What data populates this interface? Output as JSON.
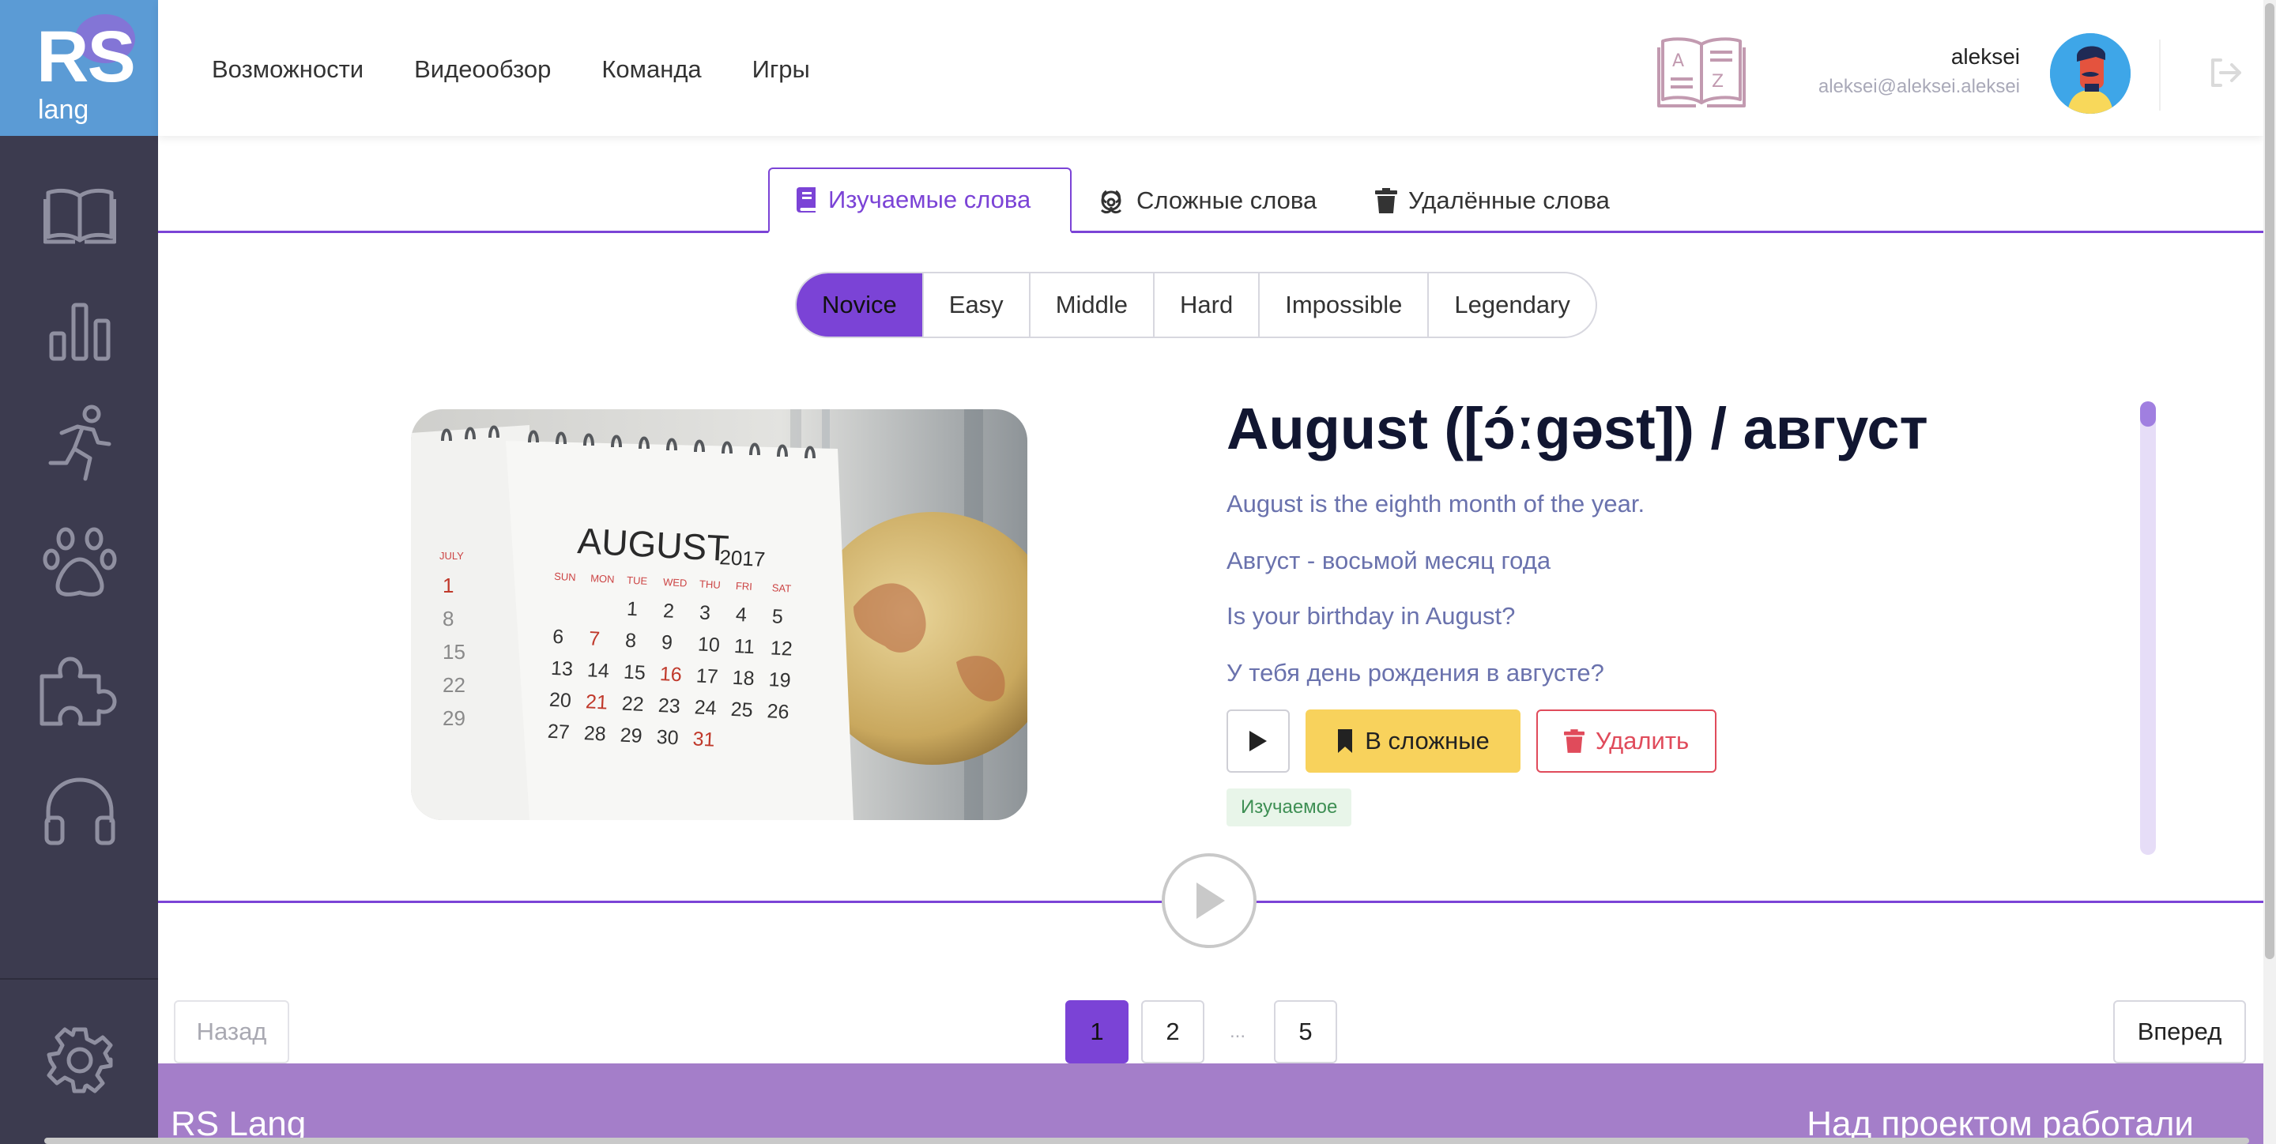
{
  "app": {
    "logo_main": "RS",
    "logo_sub": "lang"
  },
  "sidebar": {
    "items": [
      {
        "icon": "book-icon"
      },
      {
        "icon": "bar-chart-icon"
      },
      {
        "icon": "running-man-icon"
      },
      {
        "icon": "paw-icon"
      },
      {
        "icon": "puzzle-icon"
      },
      {
        "icon": "headphones-icon"
      }
    ],
    "settings_icon": "gear-icon"
  },
  "header": {
    "nav": [
      "Возможности",
      "Видеообзор",
      "Команда",
      "Игры"
    ],
    "dictionary_icon": "dictionary-az-icon",
    "user": {
      "name": "aleksei",
      "email": "aleksei@aleksei.aleksei"
    },
    "logout_icon": "logout-icon"
  },
  "tabs": [
    {
      "label": "Изучаемые слова",
      "icon": "book-icon",
      "active": true
    },
    {
      "label": "Сложные слова",
      "icon": "biohazard-icon",
      "active": false
    },
    {
      "label": "Удалённые слова",
      "icon": "trash-icon",
      "active": false
    }
  ],
  "levels": [
    "Novice",
    "Easy",
    "Middle",
    "Hard",
    "Impossible",
    "Legendary"
  ],
  "active_level": "Novice",
  "word": {
    "title": "August ([ɔ́ːgəst]) / август",
    "meaning_en": "August is the eighth month of the year.",
    "meaning_ru": "Август - восьмой месяц года",
    "example_en": "Is your birthday in August?",
    "example_ru": "У тебя день рождения в августе?",
    "image": {
      "calendar_title": "AUGUST",
      "year": "2017",
      "days_header": [
        "SUN",
        "MON",
        "TUE",
        "WED",
        "THU",
        "FRI",
        "SAT"
      ],
      "rows": [
        [
          "",
          "",
          "1",
          "2",
          "3",
          "4",
          "5"
        ],
        [
          "6",
          "7",
          "8",
          "9",
          "10",
          "11",
          "12"
        ],
        [
          "13",
          "14",
          "15",
          "16",
          "17",
          "18",
          "19"
        ],
        [
          "20",
          "21",
          "22",
          "23",
          "24",
          "25",
          "26"
        ],
        [
          "27",
          "28",
          "29",
          "30",
          "31",
          "",
          ""
        ]
      ],
      "prev_page_label": "JULY",
      "prev_page_days": [
        "1",
        "8",
        "15",
        "22",
        "29"
      ]
    },
    "buttons": {
      "play_icon": "play-icon",
      "hard_label": "В сложные",
      "hard_icon": "bookmark-icon",
      "delete_label": "Удалить",
      "delete_icon": "trash-icon"
    },
    "status": "Изучаемое"
  },
  "pagination": {
    "prev": "Назад",
    "next": "Вперед",
    "pages": [
      "1",
      "2",
      "5"
    ],
    "ellipsis": "...",
    "current": "1"
  },
  "footer": {
    "left": "RS Lang",
    "right": "Над проектом работали"
  },
  "colors": {
    "accent": "#7b43d6",
    "sidebar": "#3c3b4f",
    "logo_bg": "#5b9bd5",
    "meaning_text": "#6a72ad",
    "hard_button": "#f8d25c",
    "delete_button": "#e04b5b",
    "footer": "#a47ec9"
  }
}
